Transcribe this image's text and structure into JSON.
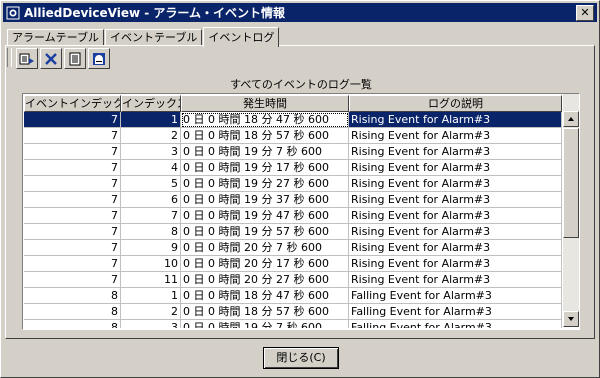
{
  "window": {
    "title": "AlliedDeviceView - アラーム・イベント情報",
    "close_glyph": "✕"
  },
  "tabs": [
    {
      "label": "アラームテーブル"
    },
    {
      "label": "イベントテーブル"
    },
    {
      "label": "イベントログ"
    }
  ],
  "toolbar": {
    "icons": [
      "export-icon",
      "delete-icon",
      "list-icon",
      "print-icon"
    ]
  },
  "table": {
    "caption": "すべてのイベントのログ一覧",
    "columns": [
      "イベントインデックス",
      "インデックス",
      "発生時間",
      "ログの説明"
    ],
    "rows": [
      [
        "7",
        "1",
        "0 日 0 時間 18 分 47 秒 600",
        "Rising Event for Alarm#3"
      ],
      [
        "7",
        "2",
        "0 日 0 時間 18 分 57 秒 600",
        "Rising Event for Alarm#3"
      ],
      [
        "7",
        "3",
        "0 日 0 時間 19 分 7 秒 600",
        "Rising Event for Alarm#3"
      ],
      [
        "7",
        "4",
        "0 日 0 時間 19 分 17 秒 600",
        "Rising Event for Alarm#3"
      ],
      [
        "7",
        "5",
        "0 日 0 時間 19 分 27 秒 600",
        "Rising Event for Alarm#3"
      ],
      [
        "7",
        "6",
        "0 日 0 時間 19 分 37 秒 600",
        "Rising Event for Alarm#3"
      ],
      [
        "7",
        "7",
        "0 日 0 時間 19 分 47 秒 600",
        "Rising Event for Alarm#3"
      ],
      [
        "7",
        "8",
        "0 日 0 時間 19 分 57 秒 600",
        "Rising Event for Alarm#3"
      ],
      [
        "7",
        "9",
        "0 日 0 時間 20 分 7 秒 600",
        "Rising Event for Alarm#3"
      ],
      [
        "7",
        "10",
        "0 日 0 時間 20 分 17 秒 600",
        "Rising Event for Alarm#3"
      ],
      [
        "7",
        "11",
        "0 日 0 時間 20 分 27 秒 600",
        "Rising Event for Alarm#3"
      ],
      [
        "8",
        "1",
        "0 日 0 時間 18 分 47 秒 600",
        "Falling Event for Alarm#3"
      ],
      [
        "8",
        "2",
        "0 日 0 時間 18 分 57 秒 600",
        "Falling Event for Alarm#3"
      ],
      [
        "8",
        "3",
        "0 日 0 時間 19 分 7 秒 600",
        "Falling Event for Alarm#3"
      ]
    ]
  },
  "buttons": {
    "close_label": "閉じる(C)"
  },
  "colors": {
    "selection": "#0a246a",
    "titlebar": "#0a246a"
  }
}
